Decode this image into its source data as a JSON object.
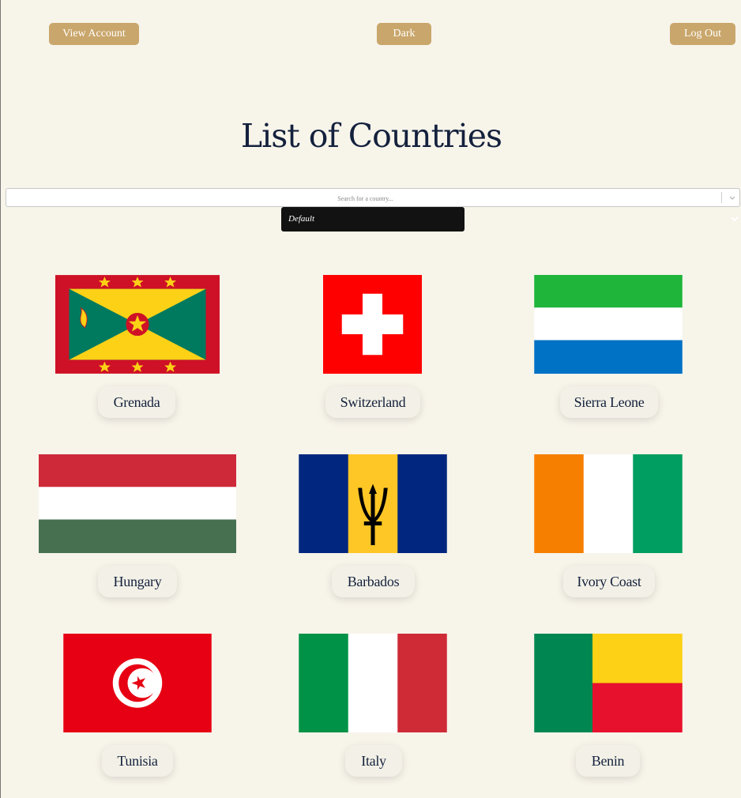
{
  "header": {
    "view_account_label": "View Account",
    "theme_label": "Dark",
    "logout_label": "Log Out"
  },
  "title": "List of Countries",
  "search": {
    "placeholder": "Search for a country...",
    "value": ""
  },
  "sort": {
    "selected": "Default"
  },
  "countries": [
    {
      "name": "Grenada",
      "flag": "grenada-flag"
    },
    {
      "name": "Switzerland",
      "flag": "switzerland-flag"
    },
    {
      "name": "Sierra Leone",
      "flag": "sierra-leone-flag"
    },
    {
      "name": "Hungary",
      "flag": "hungary-flag"
    },
    {
      "name": "Barbados",
      "flag": "barbados-flag"
    },
    {
      "name": "Ivory Coast",
      "flag": "ivory-coast-flag"
    },
    {
      "name": "Tunisia",
      "flag": "tunisia-flag"
    },
    {
      "name": "Italy",
      "flag": "italy-flag"
    },
    {
      "name": "Benin",
      "flag": "benin-flag"
    }
  ],
  "colors": {
    "background": "#f7f4ea",
    "button": "#c9a66b",
    "title": "#14213d",
    "select": "#121212"
  }
}
